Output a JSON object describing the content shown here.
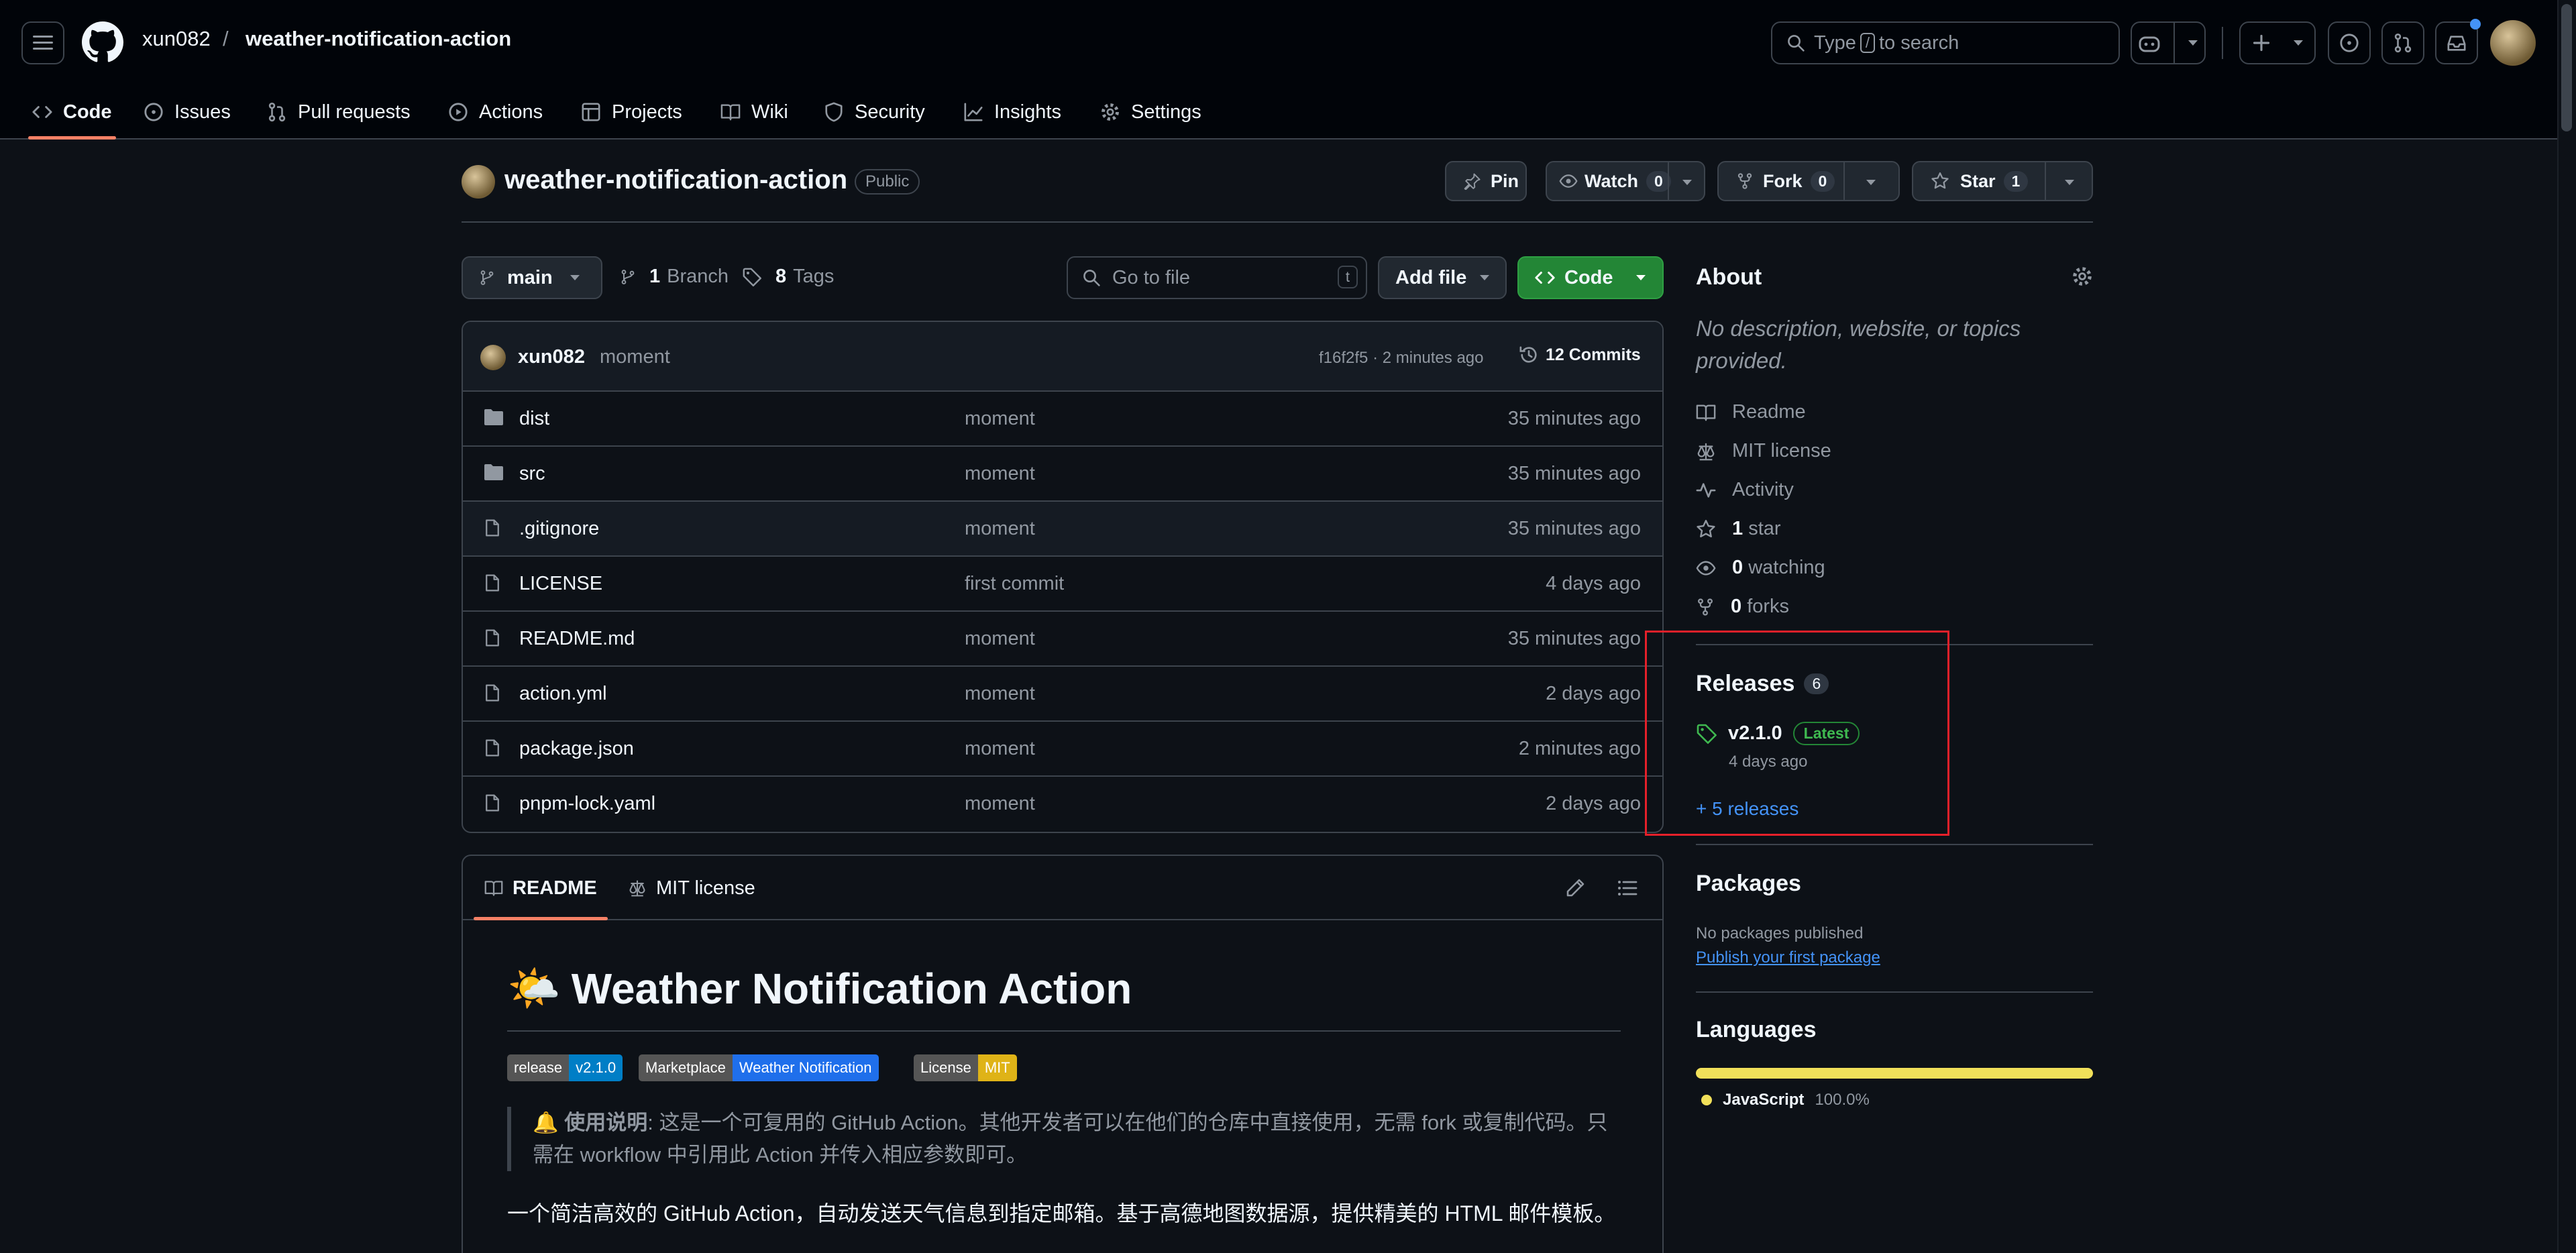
{
  "header": {
    "owner": "xun082",
    "separator": "/",
    "repo": "weather-notification-action",
    "search_prefix": "Type",
    "search_key": "/",
    "search_suffix": "to search"
  },
  "repo_nav": [
    {
      "label": "Code",
      "icon": "code-icon"
    },
    {
      "label": "Issues",
      "icon": "issue-icon"
    },
    {
      "label": "Pull requests",
      "icon": "pull-request-icon"
    },
    {
      "label": "Actions",
      "icon": "play-icon"
    },
    {
      "label": "Projects",
      "icon": "table-icon"
    },
    {
      "label": "Wiki",
      "icon": "book-icon"
    },
    {
      "label": "Security",
      "icon": "shield-icon"
    },
    {
      "label": "Insights",
      "icon": "graph-icon"
    },
    {
      "label": "Settings",
      "icon": "gear-icon"
    }
  ],
  "repo_header": {
    "name": "weather-notification-action",
    "visibility": "Public",
    "pin_label": "Pin",
    "watch_label": "Watch",
    "watch_count": "0",
    "fork_label": "Fork",
    "fork_count": "0",
    "star_label": "Star",
    "star_count": "1"
  },
  "controls": {
    "branch": "main",
    "branch_count": "1",
    "branch_label": "Branch",
    "tag_count": "8",
    "tag_label": "Tags",
    "goto_placeholder": "Go to file",
    "goto_key": "t",
    "add_file": "Add file",
    "code_button": "Code"
  },
  "latest_commit": {
    "author": "xun082",
    "message": "moment",
    "hash_time": "f16f2f5 · 2 minutes ago",
    "commits": "12 Commits"
  },
  "files": [
    {
      "name": "dist",
      "type": "folder",
      "message": "moment",
      "date": "35 minutes ago"
    },
    {
      "name": "src",
      "type": "folder",
      "message": "moment",
      "date": "35 minutes ago"
    },
    {
      "name": ".gitignore",
      "type": "file",
      "message": "moment",
      "date": "35 minutes ago"
    },
    {
      "name": "LICENSE",
      "type": "file",
      "message": "first commit",
      "date": "4 days ago"
    },
    {
      "name": "README.md",
      "type": "file",
      "message": "moment",
      "date": "35 minutes ago"
    },
    {
      "name": "action.yml",
      "type": "file",
      "message": "moment",
      "date": "2 days ago"
    },
    {
      "name": "package.json",
      "type": "file",
      "message": "moment",
      "date": "2 minutes ago"
    },
    {
      "name": "pnpm-lock.yaml",
      "type": "file",
      "message": "moment",
      "date": "2 days ago"
    }
  ],
  "readme": {
    "tab_readme": "README",
    "tab_license": "MIT license",
    "emoji": "🌤️",
    "title": "Weather Notification Action",
    "badges": [
      {
        "left": "release",
        "right": "v2.1.0",
        "color": "#007ec6"
      },
      {
        "left": "Marketplace",
        "right": "Weather Notification",
        "color": "#1f6feb"
      },
      {
        "left": "License",
        "right": "MIT",
        "color": "#dfb317"
      }
    ],
    "note_emoji": "🔔",
    "note_label": "使用说明",
    "note_text": ": 这是一个可复用的 GitHub Action。其他开发者可以在他们的仓库中直接使用，无需 fork 或复制代码。只需在 workflow 中引用此 Action 并传入相应参数即可。",
    "intro": "一个简洁高效的 GitHub Action，自动发送天气信息到指定邮箱。基于高德地图数据源，提供精美的 HTML 邮件模板。"
  },
  "about": {
    "title": "About",
    "description": "No description, website, or topics provided.",
    "items": [
      {
        "icon": "book-icon",
        "bold": "",
        "text": "Readme"
      },
      {
        "icon": "scale-icon",
        "bold": "",
        "text": "MIT license"
      },
      {
        "icon": "pulse-icon",
        "bold": "",
        "text": "Activity"
      },
      {
        "icon": "star-icon",
        "bold": "1",
        "text": "star"
      },
      {
        "icon": "eye-icon",
        "bold": "0",
        "text": "watching"
      },
      {
        "icon": "fork-icon",
        "bold": "0",
        "text": "forks"
      }
    ]
  },
  "releases": {
    "title": "Releases",
    "count": "6",
    "latest_version": "v2.1.0",
    "latest_badge": "Latest",
    "latest_date": "4 days ago",
    "more": "+ 5 releases"
  },
  "packages": {
    "title": "Packages",
    "none": "No packages published",
    "publish_link": "Publish your first package"
  },
  "languages": {
    "title": "Languages",
    "items": [
      {
        "name": "JavaScript",
        "percent": "100.0%",
        "fraction": 1.0,
        "color": "#f1e05a"
      }
    ]
  }
}
